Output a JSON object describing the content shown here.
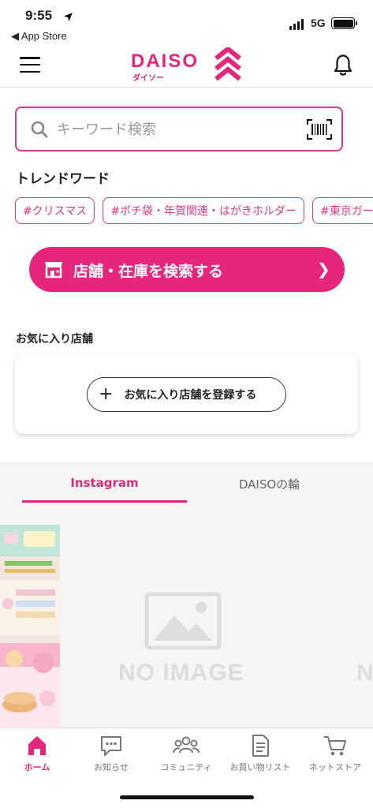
{
  "status_bar": {
    "time": "9:55",
    "back_label": "◀ App Store",
    "network": "5G"
  },
  "header": {
    "logo_text": "DAISO",
    "logo_sub": "ダイソー"
  },
  "search": {
    "placeholder": "キーワード検索"
  },
  "trend": {
    "title": "トレンドワード",
    "chips": [
      "#クリスマス",
      "#ポチ袋・年賀関連・はがきホルダー",
      "#東京ガー"
    ]
  },
  "store_search": {
    "label": "店舗・在庫を検索する",
    "arrow": "❯"
  },
  "favorites": {
    "title": "お気に入り店舗",
    "register_label": "お気に入り店舗を登録する",
    "plus": "+"
  },
  "feed_tabs": {
    "active": "Instagram",
    "other": "DAISOの輪"
  },
  "feed": {
    "placeholder_text": "NO IMAGE",
    "placeholder_text_partial": "N"
  },
  "bottom_nav": [
    {
      "label": "ホーム",
      "icon": "home-icon",
      "active": true
    },
    {
      "label": "お知らせ",
      "icon": "chat-icon",
      "active": false
    },
    {
      "label": "コミュニティ",
      "icon": "people-icon",
      "active": false
    },
    {
      "label": "お買い物リスト",
      "icon": "list-icon",
      "active": false
    },
    {
      "label": "ネットストア",
      "icon": "cart-icon",
      "active": false
    }
  ],
  "colors": {
    "brand": "#e6267c",
    "background_gray": "#f5f5f5"
  }
}
